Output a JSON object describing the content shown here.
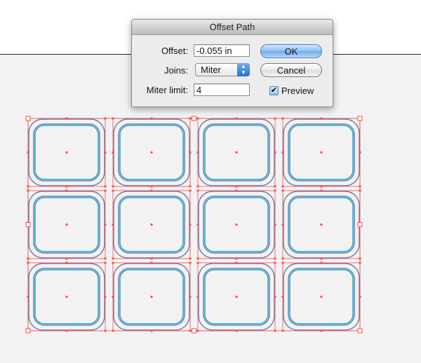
{
  "dialog": {
    "title": "Offset Path",
    "offset_label": "Offset:",
    "offset_value": "-0.055 in",
    "joins_label": "Joins:",
    "joins_value": "Miter",
    "miter_label": "Miter limit:",
    "miter_value": "4",
    "ok_label": "OK",
    "cancel_label": "Cancel",
    "preview_label": "Preview",
    "preview_checked": true
  },
  "canvas": {
    "rows": 3,
    "columns": 4,
    "selection_color": "#ff4a4a",
    "outer_path_color": "#6e7fa8",
    "offset_path_color": "#1aa6e0",
    "artboard_color": "#f2f2f2"
  }
}
